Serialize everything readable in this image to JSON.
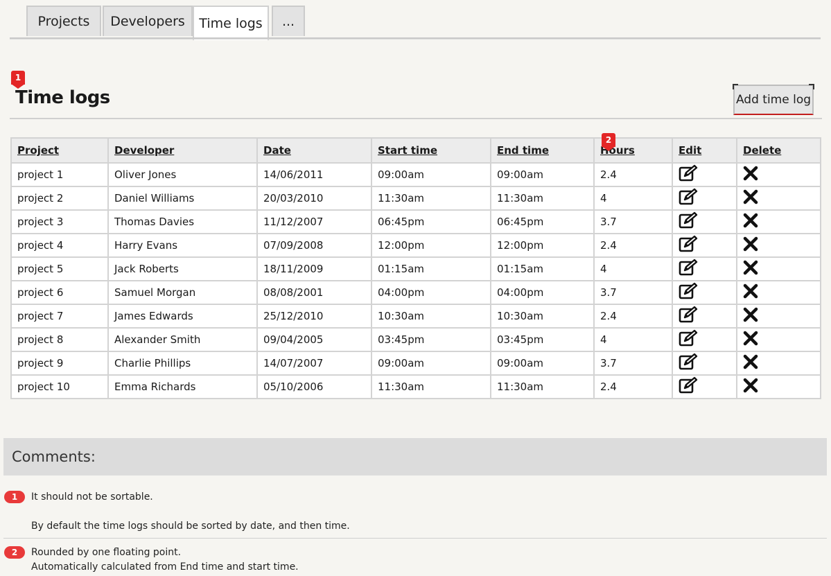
{
  "tabs": [
    {
      "label": "Projects"
    },
    {
      "label": "Developers"
    },
    {
      "label": "Time logs"
    },
    {
      "label": "..."
    }
  ],
  "page": {
    "title": "Time logs",
    "add_button_label": "Add time log",
    "markers": [
      "1",
      "2"
    ]
  },
  "table": {
    "headers": [
      "Project",
      "Developer",
      "Date",
      "Start time",
      "End time",
      "Hours",
      "Edit",
      "Delete"
    ],
    "rows": [
      [
        "project 1",
        "Oliver Jones",
        "14/06/2011",
        "09:00am",
        "09:00am",
        "2.4"
      ],
      [
        "project 2",
        "Daniel Williams",
        "20/03/2010",
        "11:30am",
        "11:30am",
        "4"
      ],
      [
        "project 3",
        "Thomas Davies",
        "11/12/2007",
        "06:45pm",
        "06:45pm",
        "3.7"
      ],
      [
        "project 4",
        "Harry Evans",
        "07/09/2008",
        "12:00pm",
        "12:00pm",
        "2.4"
      ],
      [
        "project 5",
        "Jack Roberts",
        "18/11/2009",
        "01:15am",
        "01:15am",
        "4"
      ],
      [
        "project 6",
        "Samuel Morgan",
        "08/08/2001",
        "04:00pm",
        "04:00pm",
        "3.7"
      ],
      [
        "project 7",
        "James Edwards",
        "25/12/2010",
        "10:30am",
        "10:30am",
        "2.4"
      ],
      [
        "project 8",
        "Alexander Smith",
        "09/04/2005",
        "03:45pm",
        "03:45pm",
        "4"
      ],
      [
        "project 9",
        "Charlie Phillips",
        "14/07/2007",
        "09:00am",
        "09:00am",
        "3.7"
      ],
      [
        "project 10",
        "Emma Richards",
        "05/10/2006",
        "11:30am",
        "11:30am",
        "2.4"
      ]
    ],
    "edit_icon": "edit-icon",
    "delete_icon": "close-icon"
  },
  "comments": {
    "title": "Comments:",
    "notes": [
      {
        "number": "1",
        "lines": [
          "It should not be sortable.",
          "By default the time logs should be sorted by date, and then time."
        ]
      },
      {
        "number": "2",
        "lines": [
          "Rounded by one floating point.",
          "Automatically calculated from End time and start time."
        ]
      }
    ]
  },
  "colors": {
    "accent_red": "#e32626",
    "note_pill": "#e83a3a",
    "tab_bg": "#e3e3e3",
    "comments_bg": "#dcdcdc"
  }
}
